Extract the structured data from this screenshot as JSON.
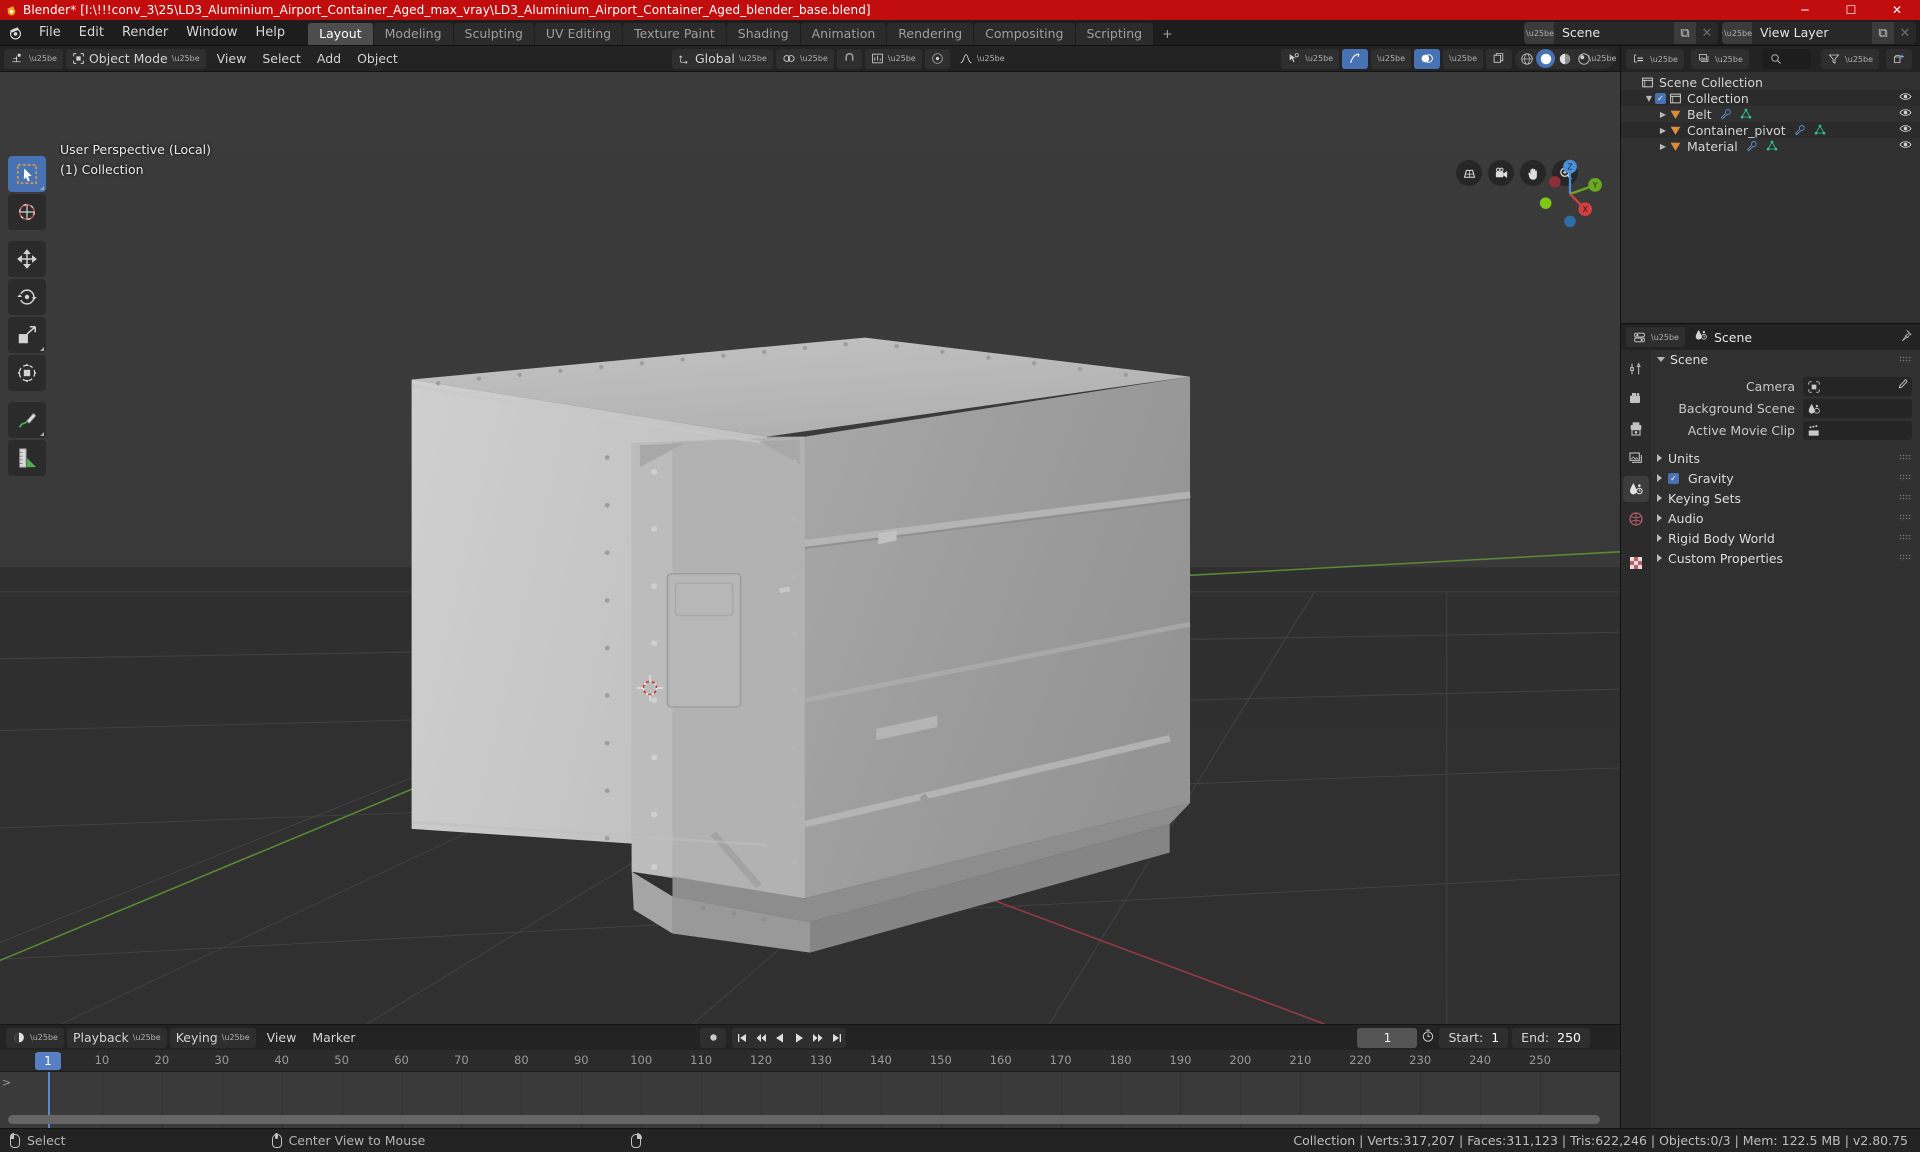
{
  "window": {
    "title": "Blender* [I:\\!!!conv_3\\25\\LD3_Aluminium_Airport_Container_Aged_max_vray\\LD3_Aluminium_Airport_Container_Aged_blender_base.blend]",
    "minimize": "─",
    "maximize": "☐",
    "close": "✕",
    "titlebar_color": "#c10d0d"
  },
  "topbar": {
    "menus": [
      "File",
      "Edit",
      "Render",
      "Window",
      "Help"
    ],
    "workspaces": [
      {
        "label": "Layout",
        "active": true
      },
      {
        "label": "Modeling",
        "active": false
      },
      {
        "label": "Sculpting",
        "active": false
      },
      {
        "label": "UV Editing",
        "active": false
      },
      {
        "label": "Texture Paint",
        "active": false
      },
      {
        "label": "Shading",
        "active": false
      },
      {
        "label": "Animation",
        "active": false
      },
      {
        "label": "Rendering",
        "active": false
      },
      {
        "label": "Compositing",
        "active": false
      },
      {
        "label": "Scripting",
        "active": false
      }
    ],
    "add_workspace": "+",
    "scene_name": "Scene",
    "view_layer_name": "View Layer",
    "copy_glyph": "⧉",
    "x_glyph": "✕"
  },
  "viewport_header": {
    "mode": "Object Mode",
    "menus": [
      "View",
      "Select",
      "Add",
      "Object"
    ],
    "transform_orientation": "Global",
    "snap_label": "snap-magnet",
    "proportional_label": "proportional-editing"
  },
  "viewport": {
    "perspective_label": "User Perspective (Local)",
    "collection_label": "(1) Collection",
    "tools": [
      "select-box-tool",
      "cursor-tool",
      "move-tool",
      "rotate-tool",
      "scale-tool",
      "transform-tool",
      "annotate-tool",
      "measure-tool"
    ],
    "nav_icons": [
      "grid-nav-icon",
      "camera-nav-icon",
      "hand-nav-icon",
      "zoom-nav-icon"
    ],
    "gizmo_axes": [
      "Z",
      "Y",
      "X"
    ]
  },
  "outliner": {
    "display_mode": "view-layer-icon",
    "filter_icon": "filter-icon",
    "new_collection_icon": "new-collection-icon",
    "search_placeholder": "",
    "rows": [
      {
        "label": "Scene Collection",
        "indent": 0,
        "icon": "collection-icon",
        "disclosure": "",
        "checkbox": false,
        "eye": false,
        "mods": []
      },
      {
        "label": "Collection",
        "indent": 1,
        "icon": "collection-icon",
        "disclosure": "▼",
        "checkbox": true,
        "eye": true,
        "mods": []
      },
      {
        "label": "Belt",
        "indent": 2,
        "icon": "object-icon",
        "disclosure": "▶",
        "checkbox": false,
        "eye": true,
        "mods": [
          "modifier-icon",
          "mesh-data-icon"
        ]
      },
      {
        "label": "Container_pivot",
        "indent": 2,
        "icon": "object-icon",
        "disclosure": "▶",
        "checkbox": false,
        "eye": true,
        "mods": [
          "modifier-icon",
          "mesh-data-icon"
        ]
      },
      {
        "label": "Material",
        "indent": 2,
        "icon": "object-icon",
        "disclosure": "▶",
        "checkbox": false,
        "eye": true,
        "mods": [
          "modifier-icon",
          "mesh-data-icon"
        ]
      }
    ]
  },
  "properties": {
    "breadcrumb": "Scene",
    "editor_icon": "properties-editor-icon",
    "pin_icon": "pin-icon",
    "tabs": [
      {
        "name": "tool-tab",
        "active": false
      },
      {
        "name": "render-tab",
        "active": false
      },
      {
        "name": "output-tab",
        "active": false
      },
      {
        "name": "view-layer-tab",
        "active": false
      },
      {
        "name": "scene-tab",
        "active": true
      },
      {
        "name": "world-tab",
        "active": false
      },
      {
        "name": "texture-tab",
        "active": false
      }
    ],
    "panel_title": "Scene",
    "fields": [
      {
        "label": "Camera",
        "value": "",
        "icon": "camera-data-icon",
        "eyedropper": true
      },
      {
        "label": "Background Scene",
        "value": "",
        "icon": "scene-data-icon",
        "eyedropper": false
      },
      {
        "label": "Active Movie Clip",
        "value": "",
        "icon": "clip-data-icon",
        "eyedropper": false
      }
    ],
    "sections": [
      {
        "label": "Units",
        "checkbox": false,
        "checked": false
      },
      {
        "label": "Gravity",
        "checkbox": true,
        "checked": true
      },
      {
        "label": "Keying Sets",
        "checkbox": false,
        "checked": false
      },
      {
        "label": "Audio",
        "checkbox": false,
        "checked": false
      },
      {
        "label": "Rigid Body World",
        "checkbox": false,
        "checked": false
      },
      {
        "label": "Custom Properties",
        "checkbox": false,
        "checked": false
      }
    ]
  },
  "timeline": {
    "editor_icon": "timeline-editor-icon",
    "menus": [
      "Playback",
      "Keying",
      "View",
      "Marker"
    ],
    "current_frame": "1",
    "start_label": "Start:",
    "start_value": "1",
    "end_label": "End:",
    "end_value": "250",
    "ticks": [
      "10",
      "20",
      "30",
      "40",
      "50",
      "60",
      "70",
      "80",
      "90",
      "100",
      "110",
      "120",
      "130",
      "140",
      "150",
      "160",
      "170",
      "180",
      "190",
      "200",
      "210",
      "220",
      "230",
      "240",
      "250"
    ],
    "playhead_frame": "1",
    "transport": [
      "jump-start-icon",
      "prev-keyframe-icon",
      "play-reverse-icon",
      "play-icon",
      "next-keyframe-icon",
      "jump-end-icon"
    ],
    "record_icon": "auto-keying-icon",
    "timer_icon": "frame-timer-icon"
  },
  "statusbar": {
    "items": [
      {
        "icon": "mouse-left-icon",
        "label": "Select"
      },
      {
        "icon": "mouse-middle-icon",
        "label": "Center View to Mouse"
      },
      {
        "icon": "mouse-right-icon",
        "label": ""
      }
    ],
    "stats": "Collection | Verts:317,207 | Faces:311,123 | Tris:622,246 | Objects:0/3 | Mem: 122.5 MB | v2.80.75"
  }
}
